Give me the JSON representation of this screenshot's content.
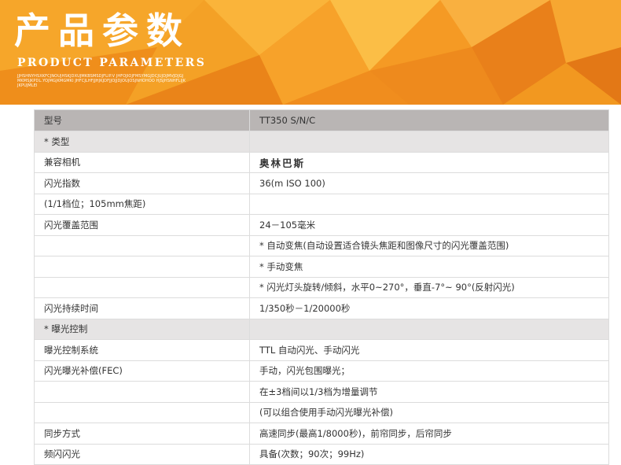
{
  "banner": {
    "title_cn": "产品参数",
    "title_en": "PRODUCT PARAMETERS",
    "subtext": "JJHSHNYHSXKFCJNOUJHSKJDXUJMKBSMSDJFLIP.V JHFOJIOJFMSYMGJDCJUJDJMVJDJGJMKMSJKPDL.YOJMGJKMGMKI JHFCJLHFJJHJKJDFJJOJJDJOUJOSJNHOHOO HJSJHSNHFLIJKJKPUJMLEI",
    "colors": {
      "orange_light": "#f9b43a",
      "orange": "#f39a1e",
      "orange_dark": "#e6801a",
      "table_header": "#b9b5b4",
      "section_row": "#e6e4e4",
      "border": "#dcdcdc"
    }
  },
  "table": {
    "rows": [
      {
        "type": "header",
        "label": "型号",
        "value": "TT350 S/N/C"
      },
      {
        "type": "section",
        "label": "* 类型",
        "value": ""
      },
      {
        "type": "row",
        "label": "兼容相机",
        "value": "奥林巴斯",
        "bold": true
      },
      {
        "type": "row",
        "label": "闪光指数",
        "value": "36(m ISO 100)"
      },
      {
        "type": "cont",
        "label": "(1/1档位；105mm焦距)",
        "value": ""
      },
      {
        "type": "row",
        "label": "闪光覆盖范围",
        "value": "24－105毫米"
      },
      {
        "type": "cont",
        "label": "",
        "value": "* 自动变焦(自动设置适合镜头焦距和图像尺寸的闪光覆盖范围)"
      },
      {
        "type": "cont",
        "label": "",
        "value": "* 手动变焦"
      },
      {
        "type": "cont",
        "label": "",
        "value": "* 闪光灯头旋转/倾斜，水平0~270°，垂直-7°~ 90°(反射闪光)"
      },
      {
        "type": "row",
        "label": "闪光持续时间",
        "value": "1/350秒－1/20000秒"
      },
      {
        "type": "section",
        "label": "* 曝光控制",
        "value": ""
      },
      {
        "type": "row",
        "label": "曝光控制系统",
        "value": "TTL 自动闪光、手动闪光"
      },
      {
        "type": "row",
        "label": "闪光曝光补偿(FEC)",
        "value": "手动，闪光包围曝光；"
      },
      {
        "type": "cont",
        "label": "",
        "value": "在±3档间以1/3档为增量调节"
      },
      {
        "type": "cont",
        "label": "",
        "value": "(可以组合使用手动闪光曝光补偿)"
      },
      {
        "type": "row",
        "label": "同步方式",
        "value": "高速同步(最高1/8000秒)，前帘同步，后帘同步"
      },
      {
        "type": "row",
        "label": "频闪闪光",
        "value": "具备(次数；90次；99Hz)"
      }
    ]
  }
}
